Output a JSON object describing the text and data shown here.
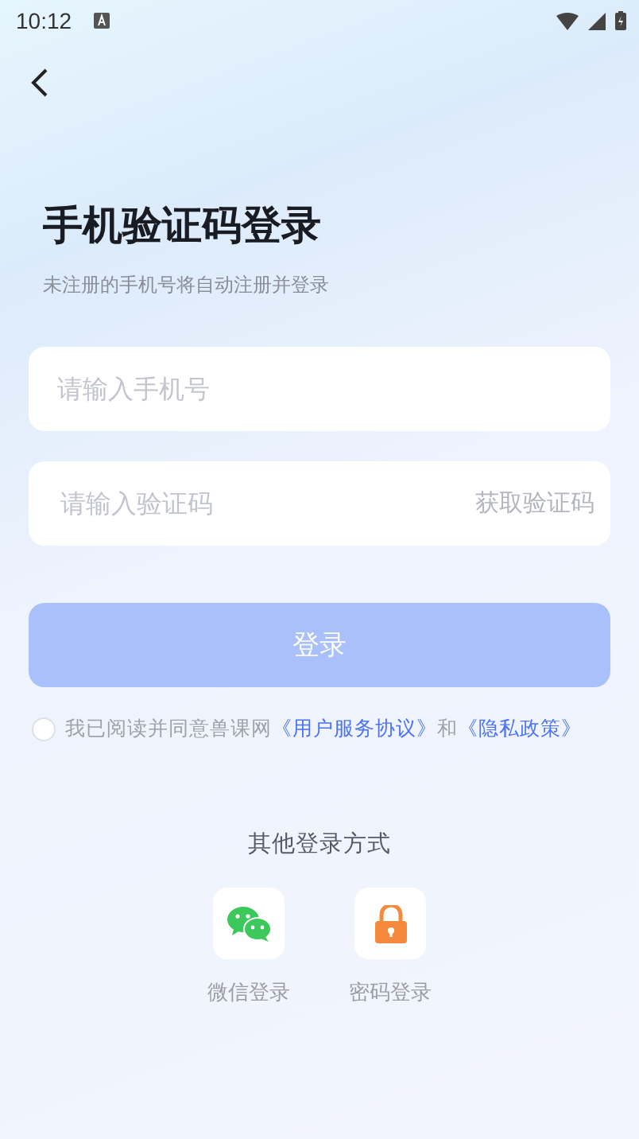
{
  "status_bar": {
    "time": "10:12"
  },
  "title": "手机验证码登录",
  "subtitle": "未注册的手机号将自动注册并登录",
  "phone_field": {
    "placeholder": "请输入手机号"
  },
  "code_field": {
    "placeholder": "请输入验证码",
    "action": "获取验证码"
  },
  "login_button": {
    "label": "登录",
    "disabled": true
  },
  "agreement": {
    "checked": false,
    "text": "我已阅读并同意兽课网",
    "link_1": "《用户服务协议》",
    "joiner": "和",
    "link_2": "《隐私政策》"
  },
  "other_methods": {
    "title": "其他登录方式",
    "items": [
      {
        "kind": "wechat",
        "label": "微信登录"
      },
      {
        "kind": "password",
        "label": "密码登录"
      }
    ]
  }
}
